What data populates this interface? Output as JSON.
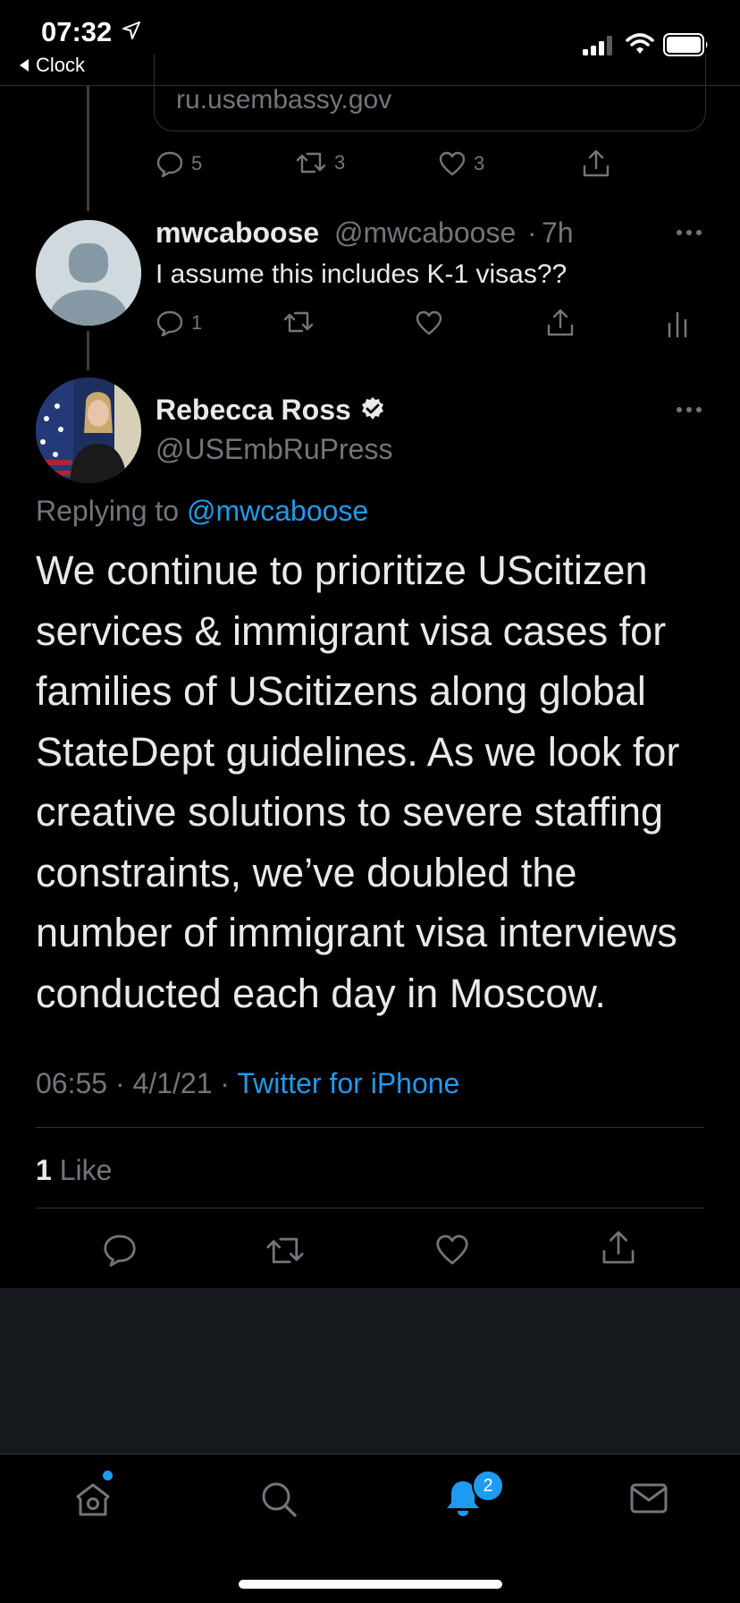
{
  "status_bar": {
    "time": "07:32",
    "back_label": "Clock"
  },
  "link_card": {
    "domain": "ru.usembassy.gov"
  },
  "link_actions": {
    "replies": "5",
    "retweets": "3",
    "likes": "3"
  },
  "reply_tweet": {
    "name": "mwcaboose",
    "handle": "@mwcaboose",
    "separator": "·",
    "time": "7h",
    "text": "I assume this includes K-1 visas??",
    "replies": "1"
  },
  "main_tweet": {
    "name": "Rebecca Ross",
    "handle": "@USEmbRuPress",
    "replying_prefix": "Replying to",
    "replying_handle": "@mwcaboose",
    "body": "We continue to prioritize UScitizen services & immigrant visa cases for families of UScitizens along global StateDept guidelines. As we look for creative solutions to severe staffing constraints, we’ve doubled the number of immigrant visa interviews conducted each day in Moscow.",
    "timestamp": "06:55 · 4/1/21 ·",
    "source": "Twitter for iPhone",
    "likes_count": "1",
    "likes_label": "Like"
  },
  "tab_bar": {
    "notification_count": "2"
  },
  "colors": {
    "accent": "#1d9bf0",
    "background": "#000000",
    "muted": "#71767b"
  }
}
